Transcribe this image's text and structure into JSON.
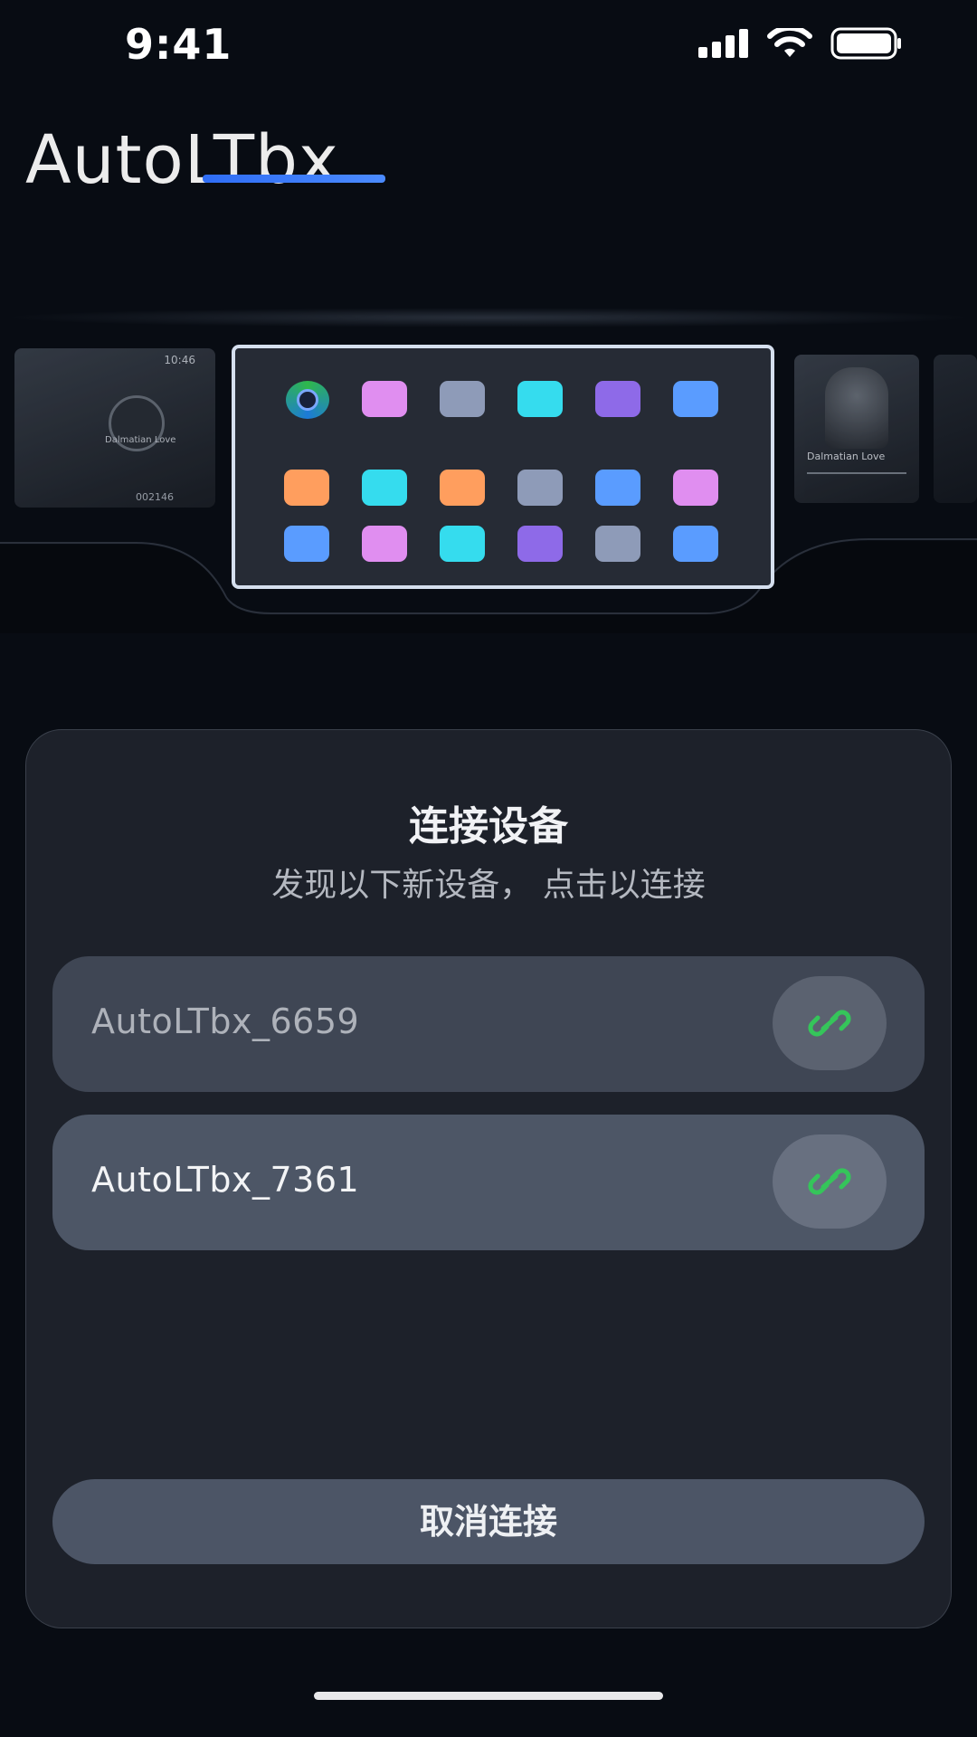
{
  "status_bar": {
    "time": "9:41",
    "icons": [
      "cellular-signal-icon",
      "wifi-icon",
      "battery-icon"
    ]
  },
  "app": {
    "title": "AutoLTbx",
    "accent": "#2f6df5"
  },
  "hero": {
    "left_panel_clock": "10:46",
    "left_panel_song": "Dalmatian Love",
    "left_panel_readout": "002146",
    "right_panel_song": "Dalmatian Love",
    "screen_icon_colors": [
      [
        "camera",
        "#e08ef0",
        "#8e9bb8",
        "#35dcee",
        "#8e6ae8",
        "#5a9cff"
      ],
      [
        "#ff9e5e",
        "#35dcee",
        "#ff9e5e",
        "#8e9bb8",
        "#5a9cff",
        "#e08ef0"
      ],
      [
        "#5a9cff",
        "#e08ef0",
        "#35dcee",
        "#8e6ae8",
        "#8e9bb8",
        "#5a9cff"
      ]
    ]
  },
  "sheet": {
    "title": "连接设备",
    "subtitle": "发现以下新设备， 点击以连接",
    "devices": [
      {
        "name": "AutoLTbx_6659",
        "icon": "link-icon"
      },
      {
        "name": "AutoLTbx_7361",
        "icon": "link-icon"
      }
    ],
    "link_icon_color": "#35c55a",
    "cancel_label": "取消连接"
  }
}
